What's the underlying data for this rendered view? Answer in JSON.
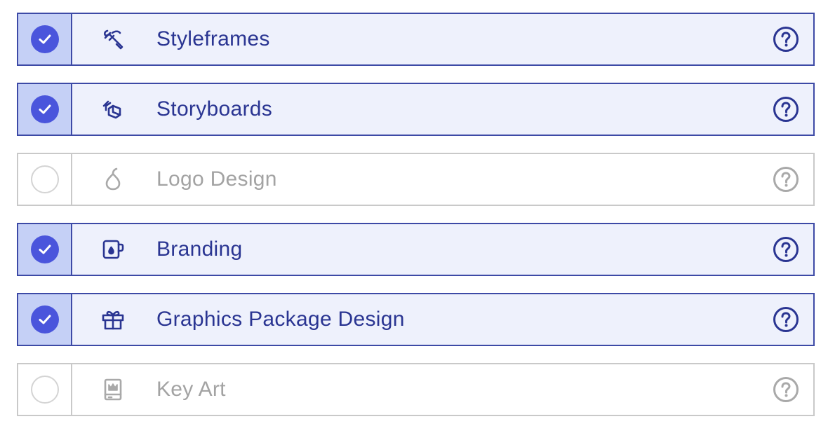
{
  "options": [
    {
      "label": "Styleframes",
      "icon": "brush-icon",
      "checked": true
    },
    {
      "label": "Storyboards",
      "icon": "layers-icon",
      "checked": true
    },
    {
      "label": "Logo Design",
      "icon": "pear-icon",
      "checked": false
    },
    {
      "label": "Branding",
      "icon": "mug-icon",
      "checked": true
    },
    {
      "label": "Graphics Package Design",
      "icon": "gift-icon",
      "checked": true
    },
    {
      "label": "Key Art",
      "icon": "poster-icon",
      "checked": false
    }
  ],
  "colors": {
    "accent": "#4a55dc",
    "text_active": "#2a3592",
    "text_inactive": "#a3a3a3",
    "row_bg_active": "#eef1fc",
    "check_bg_active": "#c5d0f6"
  }
}
